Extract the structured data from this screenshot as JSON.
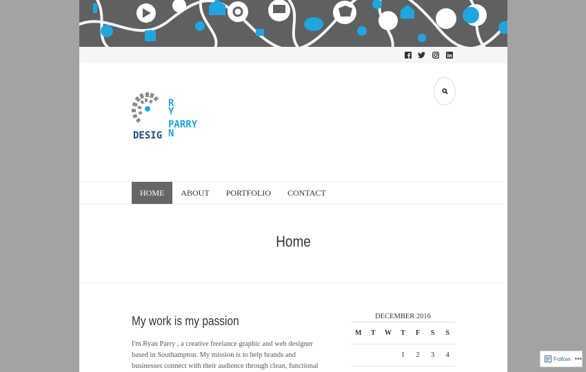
{
  "colors": {
    "accent": "#1fa6e0",
    "nav_active": "#666666",
    "banner_bg": "#5f6062"
  },
  "header": {
    "banner_icons": [
      "youtube-icon",
      "home-icon",
      "shopping-cart-icon",
      "twitter-icon",
      "chat-icon",
      "power-icon",
      "music-icon",
      "share-icon",
      "globe-icon",
      "wifi-icon"
    ],
    "social": [
      {
        "name": "facebook",
        "glyph": "f"
      },
      {
        "name": "twitter",
        "glyph": "t"
      },
      {
        "name": "instagram",
        "glyph": "◎"
      },
      {
        "name": "linkedin",
        "glyph": "in"
      }
    ]
  },
  "logo": {
    "line1": "RY",
    "line2": "AN",
    "brand_parry": "PARRY",
    "brand_design": "DESIGN"
  },
  "nav": {
    "items": [
      "HOME",
      "ABOUT",
      "PORTFOLIO",
      "CONTACT"
    ],
    "active": "HOME"
  },
  "page": {
    "title": "Home"
  },
  "post": {
    "title": "My work is my passion",
    "body": "I'm Ryan Parry , a creative freelance graphic and web designer based in Southampton. My mission is to help brands and businesses connect with their audience through clean, functional and aesthetically beautiful design."
  },
  "calendar": {
    "caption": "DECEMBER 2016",
    "days": [
      "M",
      "T",
      "W",
      "T",
      "F",
      "S",
      "S"
    ],
    "rows": [
      [
        "",
        "",
        "",
        "1",
        "2",
        "3",
        "4"
      ]
    ]
  },
  "follow": {
    "label": "Follow",
    "more": "•••"
  }
}
